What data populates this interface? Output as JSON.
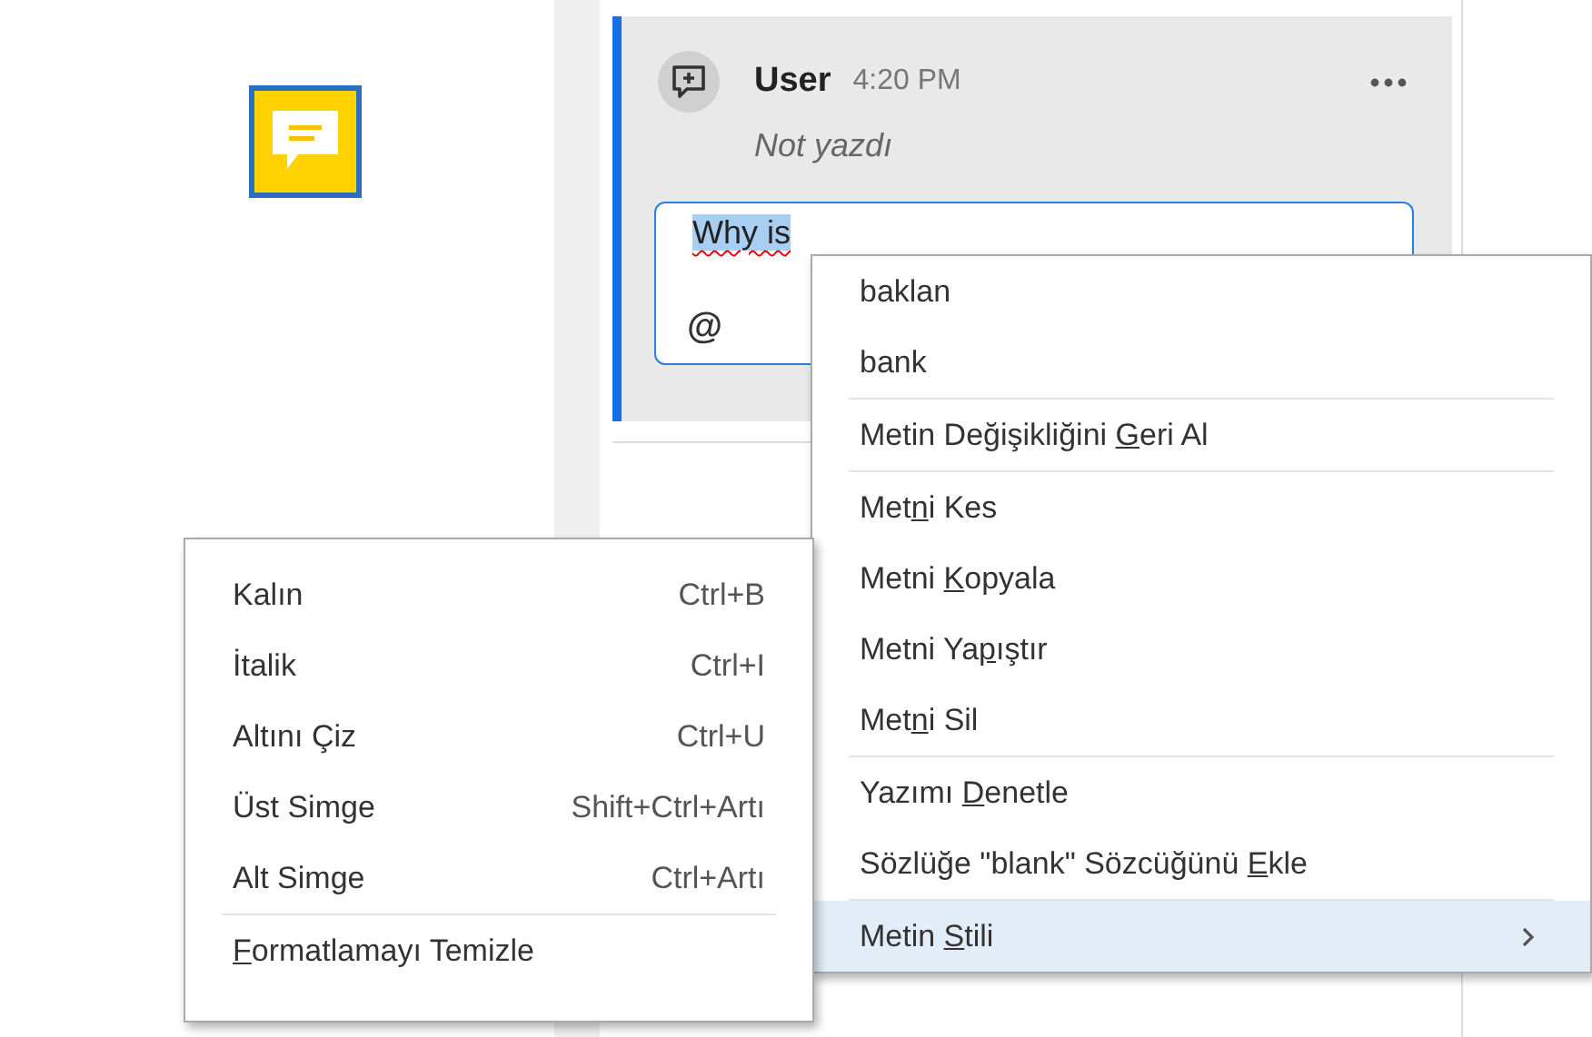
{
  "comment": {
    "author": "User",
    "time": "4:20 PM",
    "subtitle": "Not yazdı",
    "reply": {
      "value": "Why is",
      "selected": true,
      "misspelled": true,
      "mention_symbol": "@"
    }
  },
  "context_menu": {
    "groups": [
      [
        {
          "label": "baklan"
        },
        {
          "label": "bank"
        }
      ],
      [
        {
          "before": "Metin Değişikliğini ",
          "key": "G",
          "after": "eri Al"
        }
      ],
      [
        {
          "before": "Met",
          "key": "n",
          "after": "i Kes"
        },
        {
          "before": "Metni ",
          "key": "K",
          "after": "opyala"
        },
        {
          "before": "Metni Ya",
          "key": "p",
          "after": "ıştır"
        },
        {
          "before": "Met",
          "key": "n",
          "after": "i Sil"
        }
      ],
      [
        {
          "before": "Yazımı ",
          "key": "D",
          "after": "enetle"
        },
        {
          "before": "Sözlüğe \"blank\" Sözcüğünü ",
          "key": "E",
          "after": "kle"
        }
      ],
      [
        {
          "before": "Metin ",
          "key": "S",
          "after": "tili",
          "submenu": true,
          "selected": true
        }
      ]
    ]
  },
  "submenu": {
    "groups": [
      [
        {
          "label": "Kalın",
          "shortcut": "Ctrl+B"
        },
        {
          "label": "İtalik",
          "shortcut": "Ctrl+I"
        },
        {
          "label": "Altını Çiz",
          "shortcut": "Ctrl+U"
        },
        {
          "label": "Üst Simge",
          "shortcut": "Shift+Ctrl+Artı"
        },
        {
          "label": "Alt Simge",
          "shortcut": "Ctrl+Artı"
        }
      ],
      [
        {
          "key": "F",
          "after": "ormatlamayı Temizle"
        }
      ]
    ]
  }
}
